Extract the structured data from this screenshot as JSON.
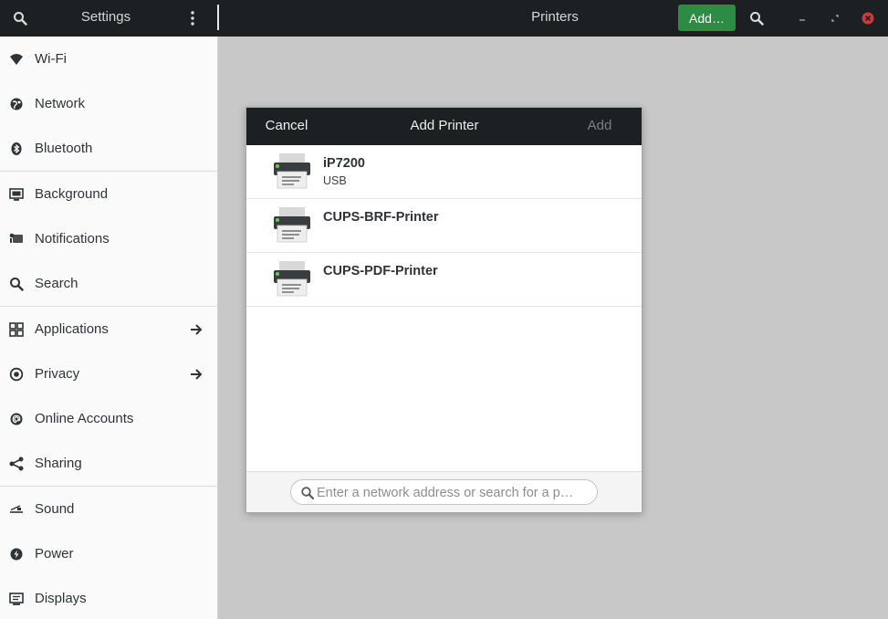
{
  "app": {
    "sidebar_title": "Settings",
    "panel_title": "Printers",
    "add_button": "Add…"
  },
  "sidebar": {
    "items": [
      {
        "label": "Wi-Fi",
        "icon": "wifi-icon"
      },
      {
        "label": "Network",
        "icon": "network-icon"
      },
      {
        "label": "Bluetooth",
        "icon": "bluetooth-icon"
      },
      {
        "label": "Background",
        "icon": "background-icon"
      },
      {
        "label": "Notifications",
        "icon": "notifications-icon"
      },
      {
        "label": "Search",
        "icon": "search-icon"
      },
      {
        "label": "Applications",
        "icon": "applications-icon",
        "arrow": true
      },
      {
        "label": "Privacy",
        "icon": "privacy-icon",
        "arrow": true
      },
      {
        "label": "Online Accounts",
        "icon": "online-accounts-icon"
      },
      {
        "label": "Sharing",
        "icon": "sharing-icon"
      },
      {
        "label": "Sound",
        "icon": "sound-icon"
      },
      {
        "label": "Power",
        "icon": "power-icon"
      },
      {
        "label": "Displays",
        "icon": "displays-icon"
      }
    ]
  },
  "dialog": {
    "cancel_label": "Cancel",
    "title": "Add Printer",
    "add_label": "Add",
    "printers": [
      {
        "name": "iP7200",
        "connection": "USB"
      },
      {
        "name": "CUPS-BRF-Printer",
        "connection": ""
      },
      {
        "name": "CUPS-PDF-Printer",
        "connection": ""
      }
    ],
    "search_placeholder": "Enter a network address or search for a p…"
  },
  "colors": {
    "headerbar": "#1d2022",
    "suggested_action": "#2c8c43",
    "close_button": "#cc3b3b",
    "background": "#c8c8c8"
  }
}
